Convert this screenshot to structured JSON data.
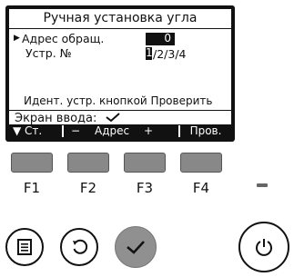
{
  "screen": {
    "title": "Ручная установка угла",
    "address_label": "Адрес обращ.",
    "address_value": "0",
    "unit_label": "Устр. №",
    "unit_selected": "1",
    "unit_rest": "/2/3/4",
    "info": "Идент. устр. кнопкой Проверить",
    "confirm_label": "Экран ввода:"
  },
  "softkeys": {
    "f1": "▼ Ст.",
    "f2_minus": "−",
    "f2_f3": "Адрес",
    "f3_plus": "+",
    "f4": "Пров."
  },
  "function_buttons": [
    "F1",
    "F2",
    "F3",
    "F4"
  ],
  "icons": {
    "pointer": "triangle-right-icon",
    "confirm": "check-icon",
    "menu": "menu-icon",
    "back": "back-arrow-icon",
    "ok": "check-icon",
    "power": "power-icon"
  },
  "colors": {
    "lcd_frame": "#111111",
    "lcd_bg": "#ffffff",
    "button_gray": "#888888"
  }
}
